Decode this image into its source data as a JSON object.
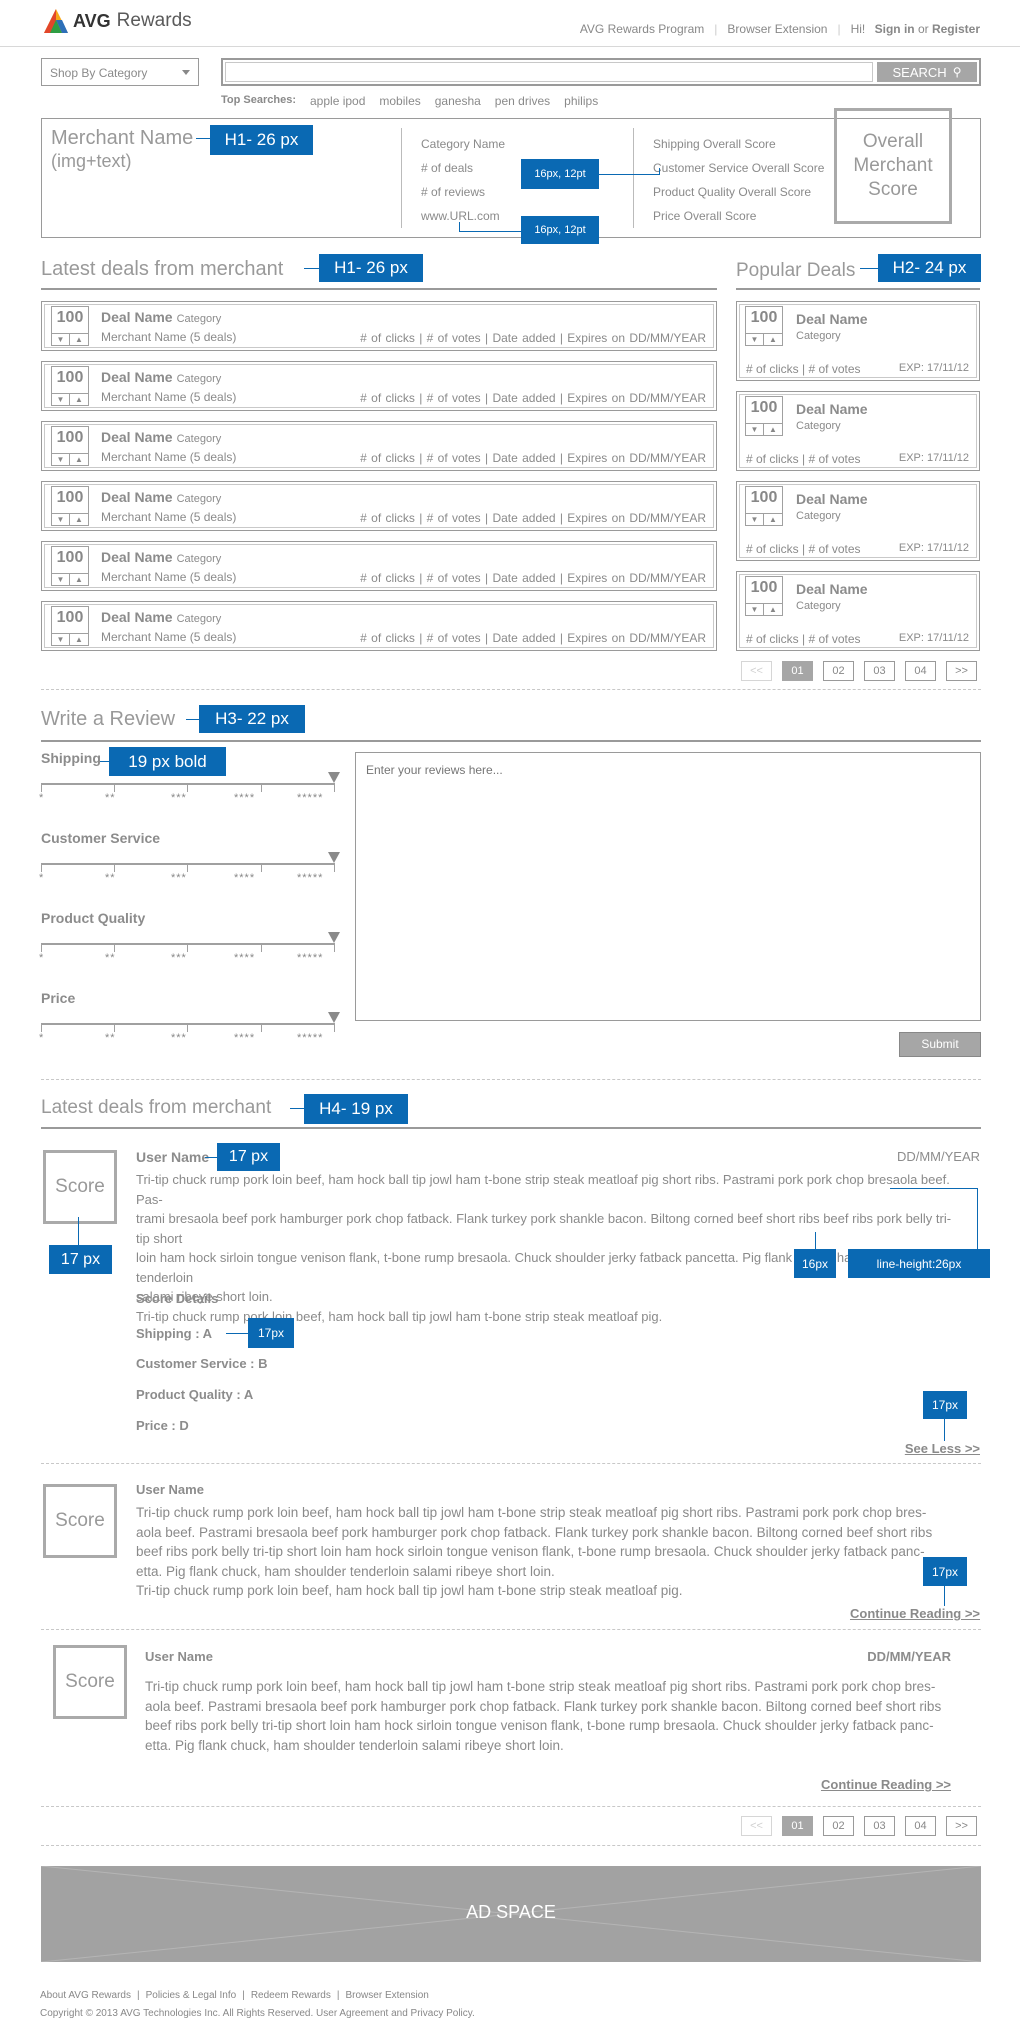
{
  "header": {
    "logo_text": "AVG",
    "app_name": "Rewards",
    "nav": [
      "AVG Rewards Program",
      "Browser Extension"
    ],
    "greeting": "Hi!",
    "sign_in": "Sign in",
    "or": "or",
    "register": "Register"
  },
  "search": {
    "category": "Shop By Category",
    "placeholder": "",
    "button": "SEARCH",
    "top_label": "Top Searches:",
    "top_terms": [
      "apple ipod",
      "mobiles",
      "ganesha",
      "pen drives",
      "philips"
    ]
  },
  "merchant": {
    "name": "Merchant Name",
    "name_sub": "(img+text)",
    "info": [
      "Category Name",
      "# of deals",
      "# of reviews",
      "www.URL.com"
    ],
    "scores": [
      "Shipping Overall Score",
      "Customer Service Overall Score",
      "Product Quality Overall Score",
      "Price Overall Score"
    ],
    "overall": [
      "Overall",
      "Merchant",
      "Score"
    ]
  },
  "latest": {
    "title": "Latest deals from merchant",
    "deals": [
      {
        "votes": "100",
        "name": "Deal Name",
        "category": "Category",
        "merchant": "Merchant Name (5 deals)",
        "meta": "# of clicks  |  # of votes  |  Date added  |  Expires on DD/MM/YEAR"
      },
      {
        "votes": "100",
        "name": "Deal Name",
        "category": "Category",
        "merchant": "Merchant Name (5 deals)",
        "meta": "# of clicks  |  # of votes  |  Date added  |  Expires on DD/MM/YEAR"
      },
      {
        "votes": "100",
        "name": "Deal Name",
        "category": "Category",
        "merchant": "Merchant Name (5 deals)",
        "meta": "# of clicks  |  # of votes  |  Date added  |  Expires on DD/MM/YEAR"
      },
      {
        "votes": "100",
        "name": "Deal Name",
        "category": "Category",
        "merchant": "Merchant Name (5 deals)",
        "meta": "# of clicks  |  # of votes  |  Date added  |  Expires on DD/MM/YEAR"
      },
      {
        "votes": "100",
        "name": "Deal Name",
        "category": "Category",
        "merchant": "Merchant Name (5 deals)",
        "meta": "# of clicks  |  # of votes  |  Date added  |  Expires on DD/MM/YEAR"
      },
      {
        "votes": "100",
        "name": "Deal Name",
        "category": "Category",
        "merchant": "Merchant Name (5 deals)",
        "meta": "# of clicks  |  # of votes  |  Date added  |  Expires on DD/MM/YEAR"
      }
    ]
  },
  "popular": {
    "title": "Popular Deals",
    "deals": [
      {
        "votes": "100",
        "name": "Deal Name",
        "category": "Category",
        "meta": "# of clicks | # of votes",
        "exp": "EXP: 17/11/12"
      },
      {
        "votes": "100",
        "name": "Deal Name",
        "category": "Category",
        "meta": "# of clicks | # of votes",
        "exp": "EXP: 17/11/12"
      },
      {
        "votes": "100",
        "name": "Deal Name",
        "category": "Category",
        "meta": "# of clicks | # of votes",
        "exp": "EXP: 17/11/12"
      },
      {
        "votes": "100",
        "name": "Deal Name",
        "category": "Category",
        "meta": "# of clicks | # of votes",
        "exp": "EXP: 17/11/12"
      }
    ]
  },
  "pager": {
    "prev": "<<",
    "pages": [
      "01",
      "02",
      "03",
      "04"
    ],
    "next": ">>",
    "active": "01"
  },
  "review_form": {
    "title": "Write a Review",
    "categories": [
      "Shipping",
      "Customer Service",
      "Product Quality",
      "Price"
    ],
    "stars": [
      "*",
      "**",
      "***",
      "****",
      "*****"
    ],
    "placeholder": "Enter your reviews here...",
    "submit": "Submit"
  },
  "reviews": {
    "title": "Latest deals from merchant",
    "score_label": "Score",
    "user": "User Name",
    "date": "DD/MM/YEAR",
    "r1_lines": [
      "Tri-tip chuck rump pork loin beef, ham hock ball tip jowl ham t-bone strip steak meatloaf pig short ribs. Pastrami pork pork chop bresaola beef. Pas-",
      "trami bresaola beef pork hamburger pork chop fatback. Flank turkey pork shankle bacon. Biltong corned beef short ribs beef ribs pork belly tri-tip short",
      "loin ham hock sirloin tongue venison flank, t-bone rump bresaola. Chuck shoulder jerky fatback pancetta. Pig flank chuck, ham shoulder tenderloin",
      "salami ribeye short loin.",
      "Tri-tip chuck rump pork loin beef, ham hock ball tip jowl ham t-bone strip steak meatloaf pig."
    ],
    "score_details": "Score Details",
    "details": [
      "Shipping : A",
      "Customer Service : B",
      "Product Quality : A",
      "Price : D"
    ],
    "see_less": "See Less >>",
    "r2_lines": [
      "Tri-tip chuck rump pork loin beef, ham hock ball tip jowl ham t-bone strip steak meatloaf pig short ribs. Pastrami pork pork chop bres-",
      "aola beef. Pastrami bresaola beef pork hamburger pork chop fatback. Flank turkey pork shankle bacon. Biltong corned beef short ribs",
      "beef ribs pork belly tri-tip short loin ham hock sirloin tongue venison flank, t-bone rump bresaola. Chuck shoulder jerky fatback panc-",
      "etta. Pig flank chuck, ham shoulder tenderloin salami ribeye short loin.",
      "Tri-tip chuck rump pork loin beef, ham hock ball tip jowl ham t-bone strip steak meatloaf pig."
    ],
    "r3_lines": [
      "Tri-tip chuck rump pork loin beef, ham hock ball tip jowl ham t-bone strip steak meatloaf pig short ribs. Pastrami pork pork chop bres-",
      "aola beef. Pastrami bresaola beef pork hamburger pork chop fatback. Flank turkey pork shankle bacon. Biltong corned beef short ribs",
      "beef ribs pork belly tri-tip short loin ham hock sirloin tongue venison flank, t-bone rump bresaola. Chuck shoulder jerky fatback panc-",
      "etta. Pig flank chuck, ham shoulder tenderloin salami ribeye short loin."
    ],
    "continue": "Continue Reading >>"
  },
  "ad": {
    "label": "AD SPACE"
  },
  "footer": {
    "links": [
      "About AVG Rewards",
      "Policies & Legal Info",
      "Redeem Rewards",
      "Browser Extension"
    ],
    "copyright": "Copyright © 2013 AVG Technologies Inc. All Rights Reserved. User Agreement and Privacy Policy."
  },
  "annotations": {
    "merchant_name": "H1- 26 px",
    "info_font": "16px, 12pt",
    "url_font": "16px, 12pt",
    "latest_title": "H1- 26 px",
    "popular_title": "H2- 24 px",
    "review_title": "H3- 22 px",
    "review_label": "19 px bold",
    "reviews_title": "H4- 19 px",
    "username": "17 px",
    "score": "17 px",
    "body": "16px",
    "line_height": "line-height:26px",
    "details": "17px",
    "see_less": "17px",
    "continue": "17px"
  },
  "colors": {
    "annotation": "#0a69b3",
    "primary_text": "#8a8a8a",
    "border": "#9a9a9a",
    "ad_bg": "#a2a2a2"
  }
}
